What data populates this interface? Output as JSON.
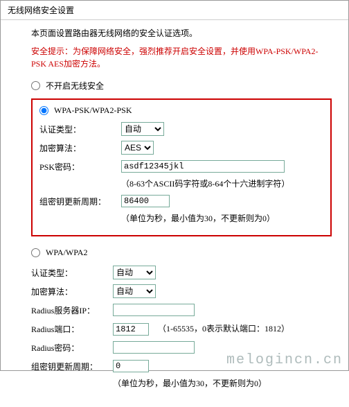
{
  "title": "无线网络安全设置",
  "intro": "本页面设置路由器无线网络的安全认证选项。",
  "warning": "安全提示：为保障网络安全，强烈推荐开启安全设置，并使用WPA-PSK/WPA2-PSK AES加密方法。",
  "options": {
    "disable_label": "不开启无线安全",
    "wpapsk_label": "WPA-PSK/WPA2-PSK",
    "wpa_label": "WPA/WPA2"
  },
  "wpapsk": {
    "auth_label": "认证类型：",
    "auth_value": "自动",
    "enc_label": "加密算法：",
    "enc_value": "AES",
    "psk_label": "PSK密码：",
    "psk_value": "asdf12345jkl",
    "psk_hint": "（8-63个ASCII码字符或8-64个十六进制字符）",
    "rekey_label": "组密钥更新周期：",
    "rekey_value": "86400",
    "rekey_hint": "（单位为秒，最小值为30，不更新则为0）"
  },
  "wpa": {
    "auth_label": "认证类型：",
    "auth_value": "自动",
    "enc_label": "加密算法：",
    "enc_value": "自动",
    "radius_ip_label": "Radius服务器IP：",
    "radius_ip_value": "",
    "radius_port_label": "Radius端口：",
    "radius_port_value": "1812",
    "radius_port_hint": "（1-65535，0表示默认端口：1812）",
    "radius_pwd_label": "Radius密码：",
    "radius_pwd_value": "",
    "rekey_label": "组密钥更新周期：",
    "rekey_value": "0",
    "rekey_hint": "（单位为秒，最小值为30，不更新则为0）"
  },
  "watermark": "melogincn.cn"
}
